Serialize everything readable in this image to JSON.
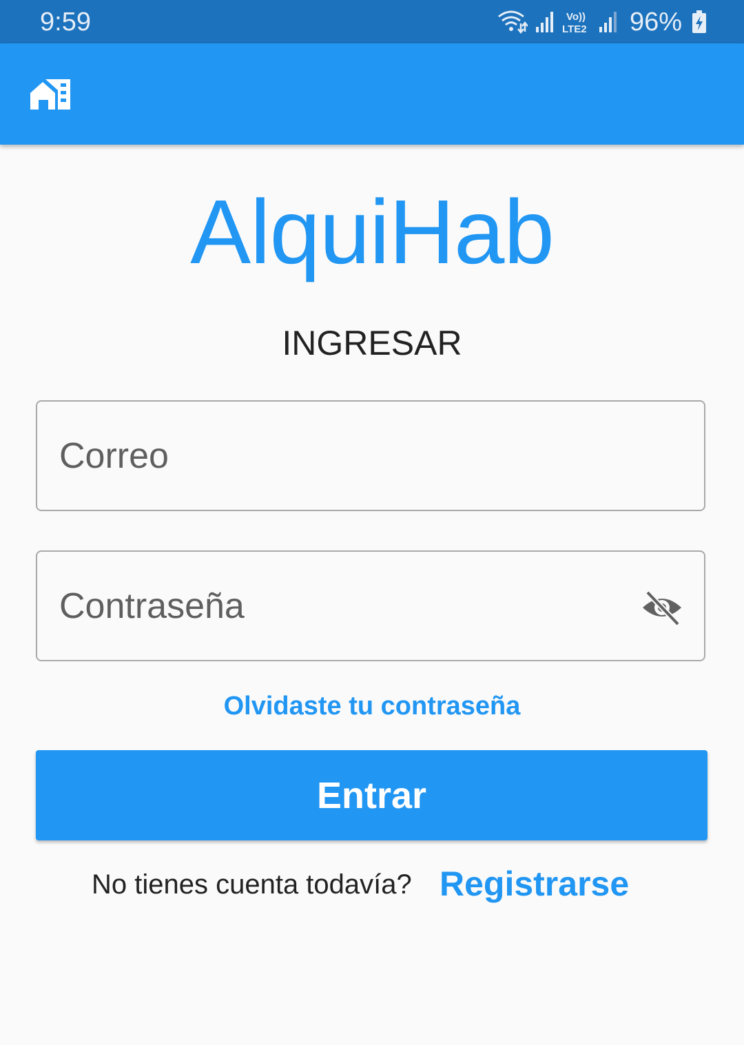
{
  "status_bar": {
    "time": "9:59",
    "battery_percent": "96%",
    "network_label": "Vo)) LTE2",
    "icons": [
      "wifi-icon",
      "signal-icon",
      "volte-icon",
      "signal-icon",
      "battery-charging-icon"
    ]
  },
  "app_bar": {
    "logo_icon": "house-logo-icon"
  },
  "brand": {
    "title": "AlquiHab"
  },
  "login": {
    "section_title": "INGRESAR",
    "email_placeholder": "Correo",
    "email_value": "",
    "password_placeholder": "Contraseña",
    "password_value": "",
    "visibility_icon": "visibility-off-icon",
    "forgot_password": "Olvidaste tu contraseña",
    "submit_label": "Entrar",
    "signup_prompt": "No tienes cuenta todavía?",
    "signup_link": "Registrarse"
  },
  "colors": {
    "primary": "#2196f3",
    "status_bar": "#1c72bd",
    "background": "#fafafa"
  }
}
